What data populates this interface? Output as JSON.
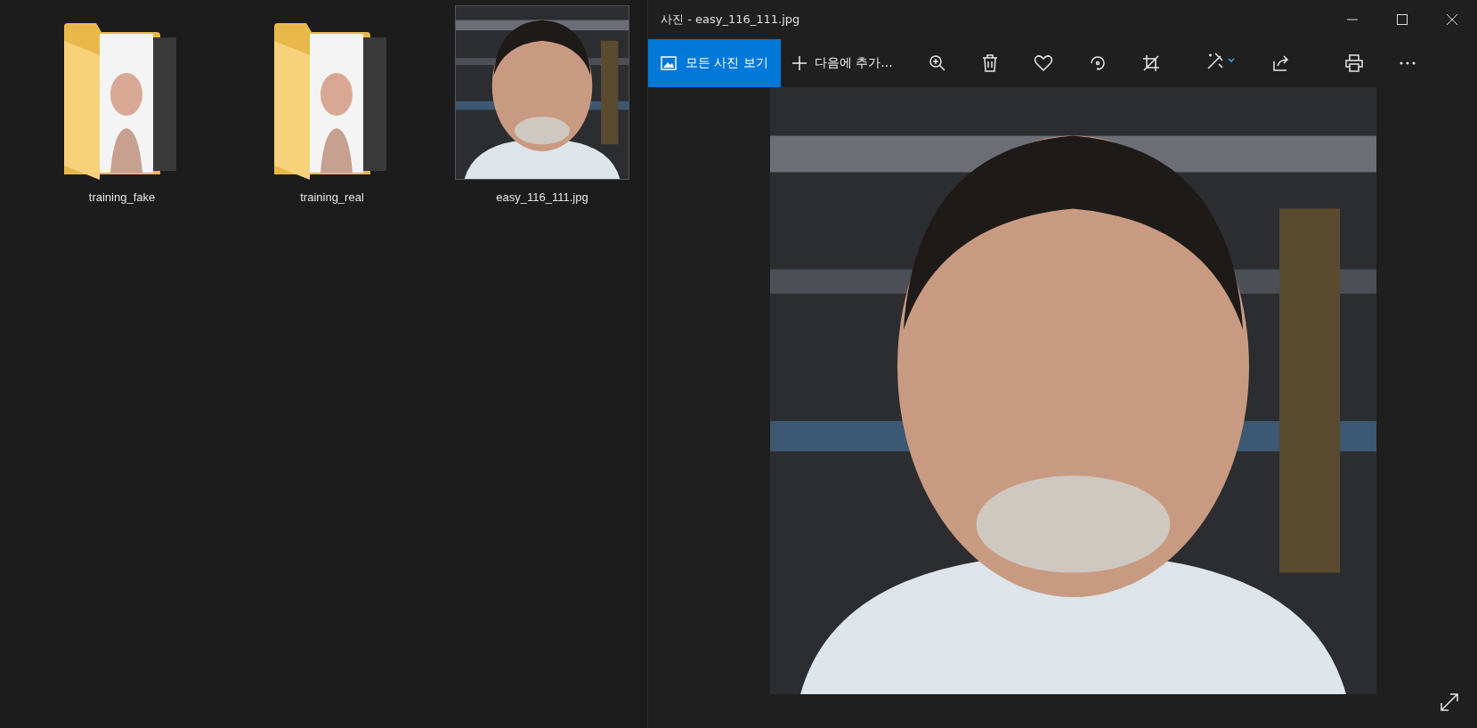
{
  "explorer": {
    "items": [
      {
        "kind": "folder",
        "name": "training_fake"
      },
      {
        "kind": "folder",
        "name": "training_real"
      },
      {
        "name": "easy_116_111.jpg"
      }
    ]
  },
  "viewer": {
    "title": "사진 - easy_116_111.jpg",
    "toolbar": {
      "all_photos": "모든 사진 보기",
      "add_to": "다음에 추가..."
    }
  }
}
